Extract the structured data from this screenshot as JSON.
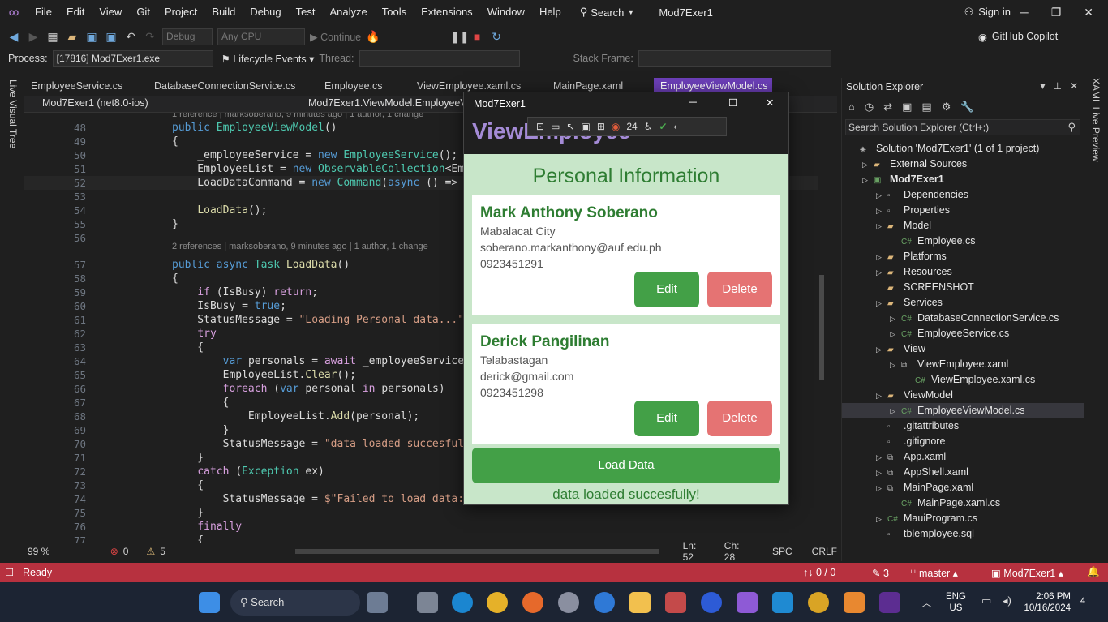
{
  "menubar": {
    "items": [
      "File",
      "Edit",
      "View",
      "Git",
      "Project",
      "Build",
      "Debug",
      "Test",
      "Analyze",
      "Tools",
      "Extensions",
      "Window",
      "Help"
    ],
    "search": "Search",
    "solution_name": "Mod7Exer1",
    "sign_in": "Sign in"
  },
  "toolbar": {
    "config": "Debug",
    "platform": "Any CPU",
    "continue": "Continue",
    "copilot": "GitHub Copilot"
  },
  "procbar": {
    "process_label": "Process:",
    "process_value": "[17816] Mod7Exer1.exe",
    "lifecycle": "Lifecycle Events",
    "thread_label": "Thread:",
    "stack_label": "Stack Frame:"
  },
  "left_strip": {
    "live_visual_tree": "Live Visual Tree"
  },
  "right_strip": {
    "xaml_live_preview": "XAML Live Preview"
  },
  "tabs": [
    "EmployeeService.cs",
    "DatabaseConnectionService.cs",
    "Employee.cs",
    "ViewEmployee.xaml.cs",
    "MainPage.xaml",
    "EmployeeViewModel.cs"
  ],
  "navbar": {
    "project": "Mod7Exer1 (net8.0-ios)",
    "member": "Mod7Exer1.ViewModel.EmployeeVie"
  },
  "code": {
    "lens1": "1 reference | marksoberano, 9 minutes ago | 1 author, 1 change",
    "lens2": "2 references | marksoberano, 9 minutes ago | 1 author, 1 change",
    "lines": [
      {
        "n": "48",
        "t": [
          [
            "kw",
            "public "
          ],
          [
            "ty",
            "EmployeeViewModel"
          ],
          [
            "id",
            "()"
          ]
        ]
      },
      {
        "n": "49",
        "t": [
          [
            "id",
            "{"
          ]
        ]
      },
      {
        "n": "50",
        "t": [
          [
            "id",
            "    _employeeService = "
          ],
          [
            "kw",
            "new "
          ],
          [
            "ty",
            "EmployeeService"
          ],
          [
            "id",
            "();"
          ]
        ]
      },
      {
        "n": "51",
        "t": [
          [
            "id",
            "    EmployeeList = "
          ],
          [
            "kw",
            "new "
          ],
          [
            "ty",
            "ObservableCollection"
          ],
          [
            "id",
            "<Empl"
          ]
        ]
      },
      {
        "n": "52",
        "t": [
          [
            "id",
            "    LoadDataCommand = "
          ],
          [
            "kw",
            "new "
          ],
          [
            "ty",
            "Command"
          ],
          [
            "id",
            "("
          ],
          [
            "kw",
            "async "
          ],
          [
            "id",
            "() => aw"
          ]
        ]
      },
      {
        "n": "53",
        "t": []
      },
      {
        "n": "54",
        "t": [
          [
            "id",
            "    "
          ],
          [
            "fn",
            "LoadData"
          ],
          [
            "id",
            "();"
          ]
        ]
      },
      {
        "n": "55",
        "t": [
          [
            "id",
            "}"
          ]
        ]
      },
      {
        "n": "56",
        "t": []
      },
      {
        "n": "57",
        "t": [
          [
            "kw",
            "public async "
          ],
          [
            "ty",
            "Task "
          ],
          [
            "fn",
            "LoadData"
          ],
          [
            "id",
            "()"
          ]
        ]
      },
      {
        "n": "58",
        "t": [
          [
            "id",
            "{"
          ]
        ]
      },
      {
        "n": "59",
        "t": [
          [
            "id",
            "    "
          ],
          [
            "ct",
            "if "
          ],
          [
            "id",
            "(IsBusy) "
          ],
          [
            "ct",
            "return"
          ],
          [
            "id",
            ";"
          ]
        ]
      },
      {
        "n": "60",
        "t": [
          [
            "id",
            "    IsBusy = "
          ],
          [
            "kw",
            "true"
          ],
          [
            "id",
            ";"
          ]
        ]
      },
      {
        "n": "61",
        "t": [
          [
            "id",
            "    StatusMessage = "
          ],
          [
            "st",
            "\"Loading Personal data...\""
          ],
          [
            "id",
            ";"
          ]
        ]
      },
      {
        "n": "62",
        "t": [
          [
            "id",
            "    "
          ],
          [
            "ct",
            "try"
          ]
        ]
      },
      {
        "n": "63",
        "t": [
          [
            "id",
            "    {"
          ]
        ]
      },
      {
        "n": "64",
        "t": [
          [
            "id",
            "        "
          ],
          [
            "kw",
            "var "
          ],
          [
            "id",
            "personals = "
          ],
          [
            "ct",
            "await "
          ],
          [
            "id",
            "_employeeService.G"
          ]
        ]
      },
      {
        "n": "65",
        "t": [
          [
            "id",
            "        EmployeeList."
          ],
          [
            "fn",
            "Clear"
          ],
          [
            "id",
            "();"
          ]
        ]
      },
      {
        "n": "66",
        "t": [
          [
            "id",
            "        "
          ],
          [
            "ct",
            "foreach "
          ],
          [
            "id",
            "("
          ],
          [
            "kw",
            "var "
          ],
          [
            "id",
            "personal "
          ],
          [
            "ct",
            "in "
          ],
          [
            "id",
            "personals)"
          ]
        ]
      },
      {
        "n": "67",
        "t": [
          [
            "id",
            "        {"
          ]
        ]
      },
      {
        "n": "68",
        "t": [
          [
            "id",
            "            EmployeeList."
          ],
          [
            "fn",
            "Add"
          ],
          [
            "id",
            "(personal);"
          ]
        ]
      },
      {
        "n": "69",
        "t": [
          [
            "id",
            "        }"
          ]
        ]
      },
      {
        "n": "70",
        "t": [
          [
            "id",
            "        StatusMessage = "
          ],
          [
            "st",
            "\"data loaded succesfully"
          ]
        ]
      },
      {
        "n": "71",
        "t": [
          [
            "id",
            "    }"
          ]
        ]
      },
      {
        "n": "72",
        "t": [
          [
            "id",
            "    "
          ],
          [
            "ct",
            "catch "
          ],
          [
            "id",
            "("
          ],
          [
            "ty",
            "Exception "
          ],
          [
            "id",
            "ex)"
          ]
        ]
      },
      {
        "n": "73",
        "t": [
          [
            "id",
            "    {"
          ]
        ]
      },
      {
        "n": "74",
        "t": [
          [
            "id",
            "        StatusMessage = "
          ],
          [
            "st",
            "$\"Failed to load data: {"
          ]
        ]
      },
      {
        "n": "75",
        "t": [
          [
            "id",
            "    }"
          ]
        ]
      },
      {
        "n": "76",
        "t": [
          [
            "id",
            "    "
          ],
          [
            "ct",
            "finally"
          ]
        ]
      },
      {
        "n": "77",
        "t": [
          [
            "id",
            "    {"
          ]
        ]
      }
    ]
  },
  "editor_status": {
    "zoom": "99 %",
    "errors": "0",
    "warnings": "5",
    "ln": "Ln: 52",
    "ch": "Ch: 28",
    "spc": "SPC",
    "crlf": "CRLF"
  },
  "solution_explorer": {
    "title": "Solution Explorer",
    "search_placeholder": "Search Solution Explorer (Ctrl+;)",
    "items": [
      "Solution 'Mod7Exer1' (1 of 1 project)",
      "External Sources",
      "Mod7Exer1",
      "Dependencies",
      "Properties",
      "Model",
      "Employee.cs",
      "Platforms",
      "Resources",
      "SCREENSHOT",
      "Services",
      "DatabaseConnectionService.cs",
      "EmployeeService.cs",
      "View",
      "ViewEmployee.xaml",
      "ViewEmployee.xaml.cs",
      "ViewModel",
      "EmployeeViewModel.cs",
      ".gitattributes",
      ".gitignore",
      "App.xaml",
      "AppShell.xaml",
      "MainPage.xaml",
      "MainPage.xaml.cs",
      "MauiProgram.cs",
      "tblemployee.sql"
    ]
  },
  "app": {
    "window_title": "Mod7Exer1",
    "page_title": "ViewEmployee",
    "heading": "Personal Information",
    "debug_count": "24",
    "employees": [
      {
        "name": "Mark Anthony Soberano",
        "address": "Mabalacat City",
        "email": "soberano.markanthony@auf.edu.ph",
        "phone": "0923451291"
      },
      {
        "name": "Derick Pangilinan",
        "address": "Telabastagan",
        "email": "derick@gmail.com",
        "phone": "0923451298"
      }
    ],
    "edit": "Edit",
    "delete": "Delete",
    "load": "Load Data",
    "status_message": "data loaded succesfully!"
  },
  "statusbar": {
    "ready": "Ready",
    "changes": "0 / 0",
    "pencil": "3",
    "branch": "master",
    "project": "Mod7Exer1"
  },
  "taskbar": {
    "search": "Search",
    "lang1": "ENG",
    "lang2": "US",
    "time": "2:06 PM",
    "date": "10/16/2024",
    "badge": "4"
  }
}
